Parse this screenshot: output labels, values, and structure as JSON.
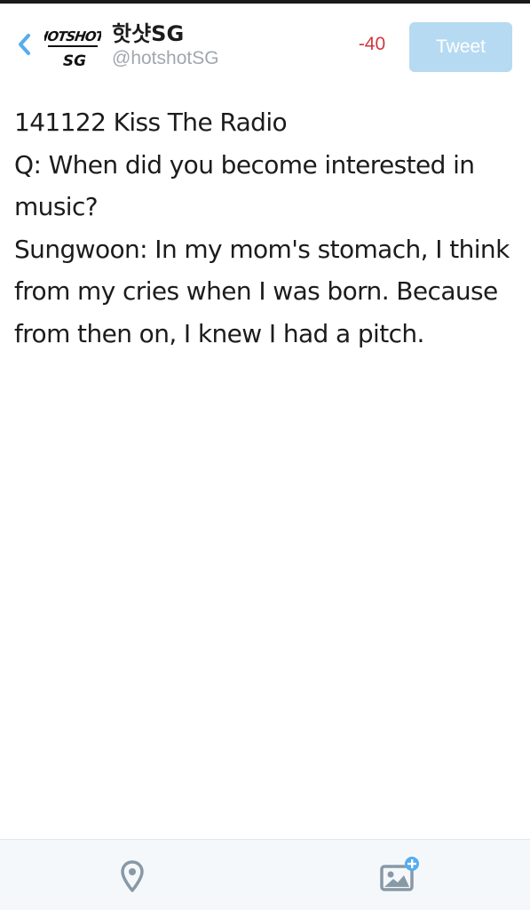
{
  "header": {
    "back_icon": "chevron-left-icon",
    "avatar_logo_text": "HOTSHOT SG",
    "display_name": "핫샷SG",
    "handle": "@hotshotSG",
    "char_count": "-40",
    "tweet_label": "Tweet"
  },
  "compose": {
    "lines": [
      "141122 Kiss The Radio",
      "Q: When did you become interested in",
      "music?",
      "Sungwoon: In my mom's stomach, I think",
      "from my cries when I was born. Because",
      "from then on, I knew I had a pitch."
    ]
  },
  "toolbar": {
    "location_icon": "location-pin-icon",
    "photo_icon": "add-photo-icon"
  },
  "colors": {
    "accent": "#55acee",
    "tweet_button_disabled": "#b6daf2",
    "char_count_over": "#d0393f",
    "handle_gray": "#a0a7ae",
    "icon_gray": "#8899a6",
    "bottom_bar_bg": "#f5f8fa"
  }
}
